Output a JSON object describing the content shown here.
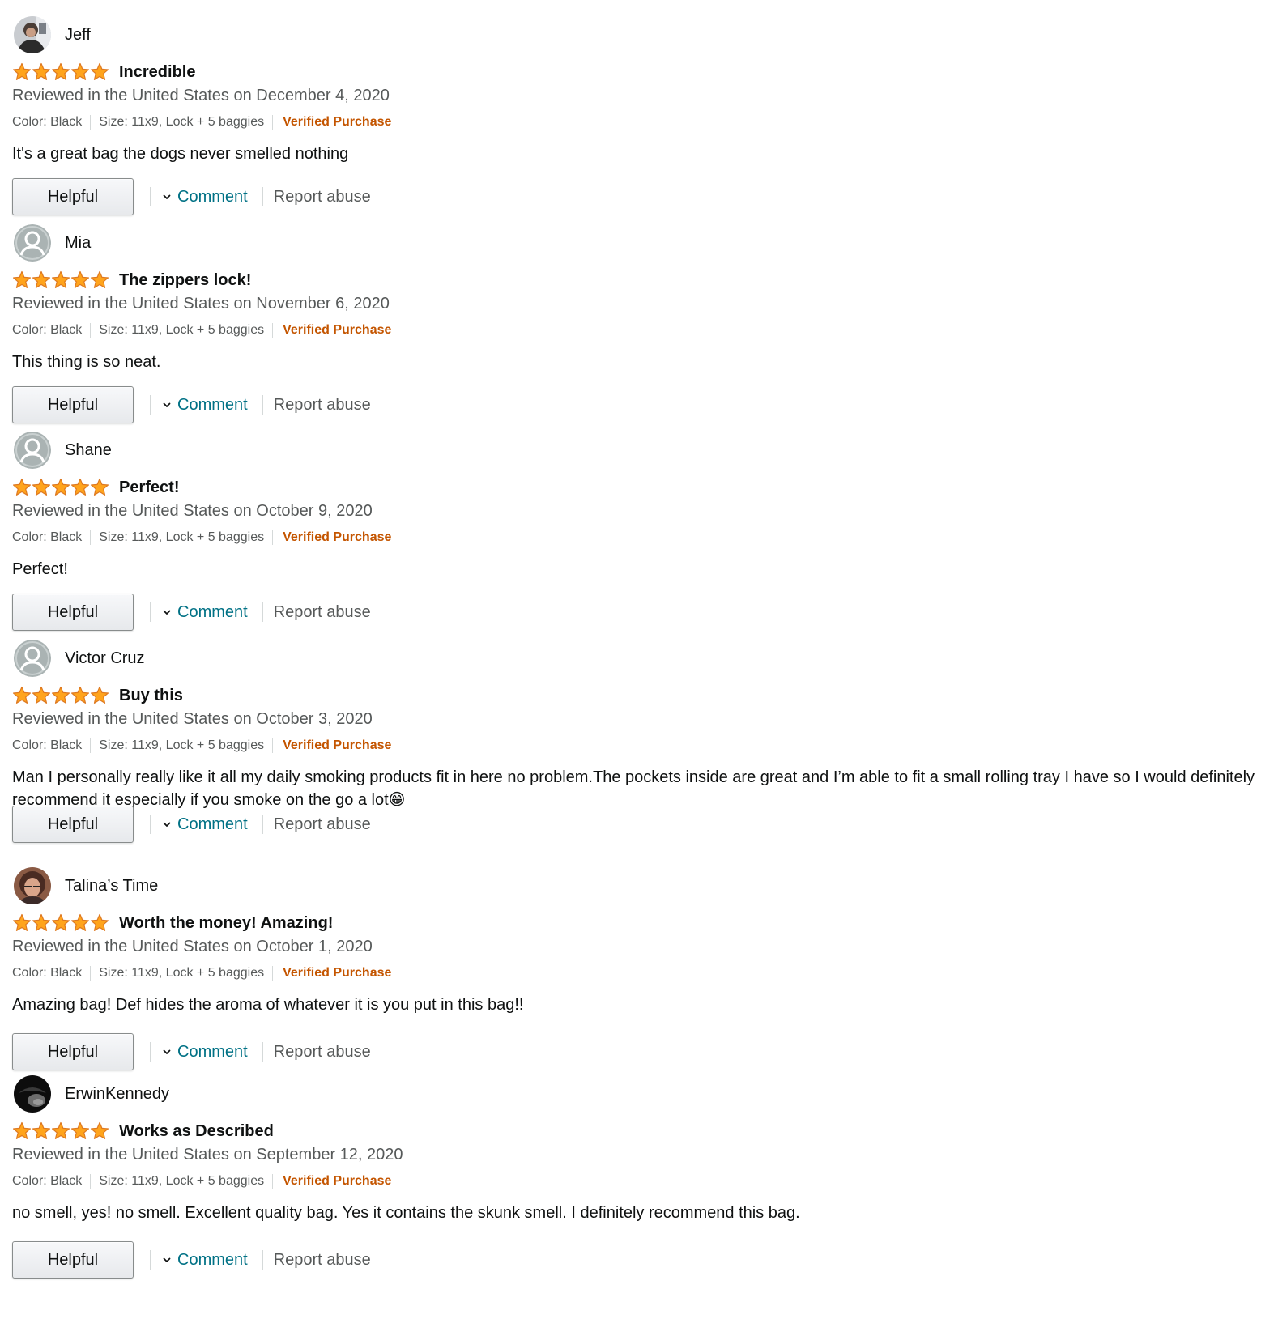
{
  "colors": {
    "star_fill": "#ffa41c",
    "star_stroke": "#de7921",
    "verified": "#c45500",
    "link": "#007185",
    "muted": "#565959"
  },
  "labels": {
    "helpful": "Helpful",
    "comment": "Comment",
    "report_abuse": "Report abuse",
    "verified_purchase": "Verified Purchase",
    "comment_icon": "chevron-down-icon"
  },
  "reviews": [
    {
      "name": "Jeff",
      "avatar": "photo",
      "rating": 5,
      "title": "Incredible",
      "date": "Reviewed in the United States on December 4, 2020",
      "color": "Color: Black",
      "size": "Size: 11x9, Lock + 5 baggies",
      "body": "It's a great bag the dogs never smelled nothing"
    },
    {
      "name": "Mia",
      "avatar": "default-user-icon",
      "rating": 5,
      "title": "The zippers lock!",
      "date": "Reviewed in the United States on November 6, 2020",
      "color": "Color: Black",
      "size": "Size: 11x9, Lock + 5 baggies",
      "body": "This thing is so neat."
    },
    {
      "name": "Shane",
      "avatar": "default-user-icon",
      "rating": 5,
      "title": "Perfect!",
      "date": "Reviewed in the United States on October 9, 2020",
      "color": "Color: Black",
      "size": "Size: 11x9, Lock + 5 baggies",
      "body": "Perfect!"
    },
    {
      "name": "Victor Cruz",
      "avatar": "default-user-icon",
      "rating": 5,
      "title": "Buy this",
      "date": "Reviewed in the United States on October 3, 2020",
      "color": "Color: Black",
      "size": "Size: 11x9, Lock + 5 baggies",
      "body": "Man I personally really like it all my daily smoking products fit in here no problem.The pockets inside are great and I’m able to fit a small rolling tray I have so I would definitely recommend it especially if you smoke on the go a lot😁"
    },
    {
      "name": "Talina’s Time",
      "avatar": "photo",
      "rating": 5,
      "title": "Worth the money! Amazing!",
      "date": "Reviewed in the United States on October 1, 2020",
      "color": "Color: Black",
      "size": "Size: 11x9, Lock + 5 baggies",
      "body": "Amazing bag! Def hides the aroma of whatever it is you put in this bag!!"
    },
    {
      "name": "ErwinKennedy",
      "avatar": "photo",
      "rating": 5,
      "title": "Works as Described",
      "date": "Reviewed in the United States on September 12, 2020",
      "color": "Color: Black",
      "size": "Size: 11x9, Lock + 5 baggies",
      "body": "no smell, yes! no smell. Excellent quality bag. Yes it contains the skunk smell. I definitely recommend this bag."
    }
  ]
}
